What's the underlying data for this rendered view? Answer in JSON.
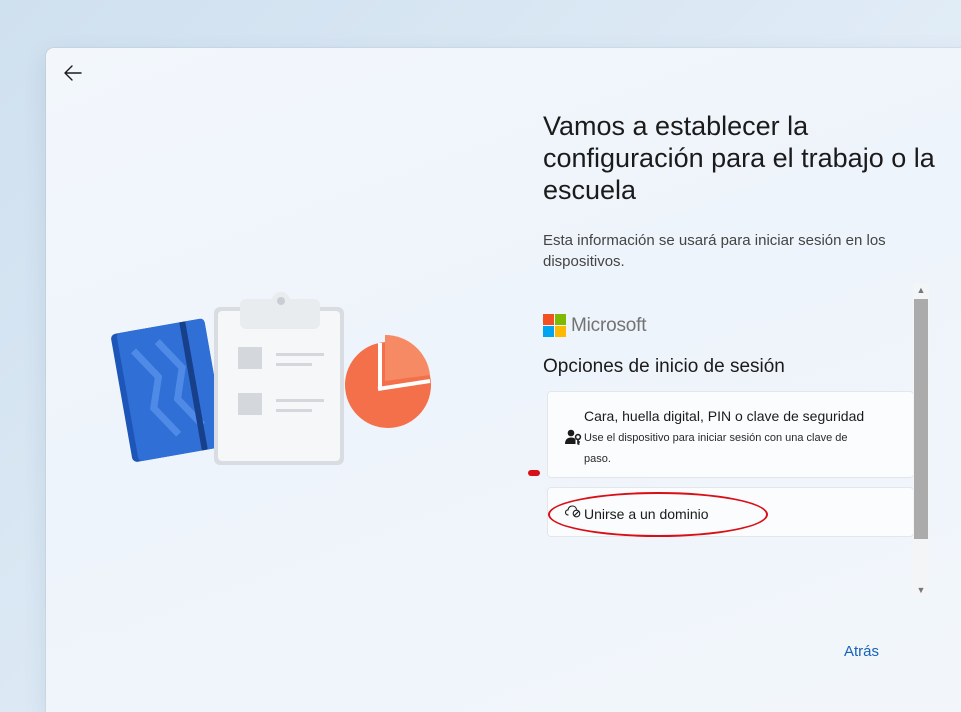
{
  "header": {
    "title": "Vamos a establecer la configuración para el trabajo o la escuela",
    "subtitle": "Esta información se usará para iniciar sesión en los dispositivos."
  },
  "brand": {
    "name": "Microsoft",
    "colors": [
      "#f25022",
      "#7fba00",
      "#00a4ef",
      "#ffb900"
    ]
  },
  "signin": {
    "heading": "Opciones de inicio de sesión",
    "options": [
      {
        "icon": "user-key-icon",
        "title": "Cara, huella digital, PIN o clave de seguridad",
        "description": "Use el dispositivo para iniciar sesión con una clave de paso."
      },
      {
        "icon": "cloud-domain-icon",
        "title": "Unirse a un dominio"
      }
    ]
  },
  "footer": {
    "back_label": "Atrás"
  },
  "colors": {
    "accent": "#1862b8",
    "highlight": "#d80f16"
  }
}
